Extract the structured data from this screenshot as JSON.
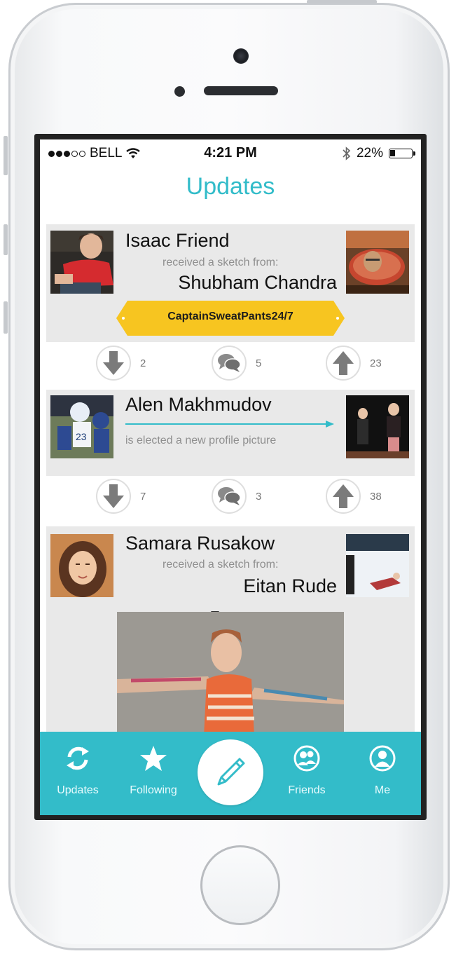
{
  "status_bar": {
    "carrier": "BELL",
    "time": "4:21 PM",
    "battery": "22%"
  },
  "header": {
    "title": "Updates"
  },
  "feed": [
    {
      "name": "Isaac Friend",
      "action": "received a sketch from:",
      "sender": "Shubham Chandra",
      "badge": "CaptainSweatPants24/7",
      "downvotes": "2",
      "comments": "5",
      "upvotes": "23"
    },
    {
      "name": "Alen Makhmudov",
      "action": "is elected a new profile picture",
      "downvotes": "7",
      "comments": "3",
      "upvotes": "38"
    },
    {
      "name": "Samara Rusakow",
      "action": "received a sketch from:",
      "sender": "Eitan Rude"
    }
  ],
  "tabbar": {
    "updates": "Updates",
    "following": "Following",
    "friends": "Friends",
    "me": "Me"
  },
  "colors": {
    "accent": "#33bcc9",
    "badge": "#f7c520",
    "card": "#e9e9e9"
  }
}
